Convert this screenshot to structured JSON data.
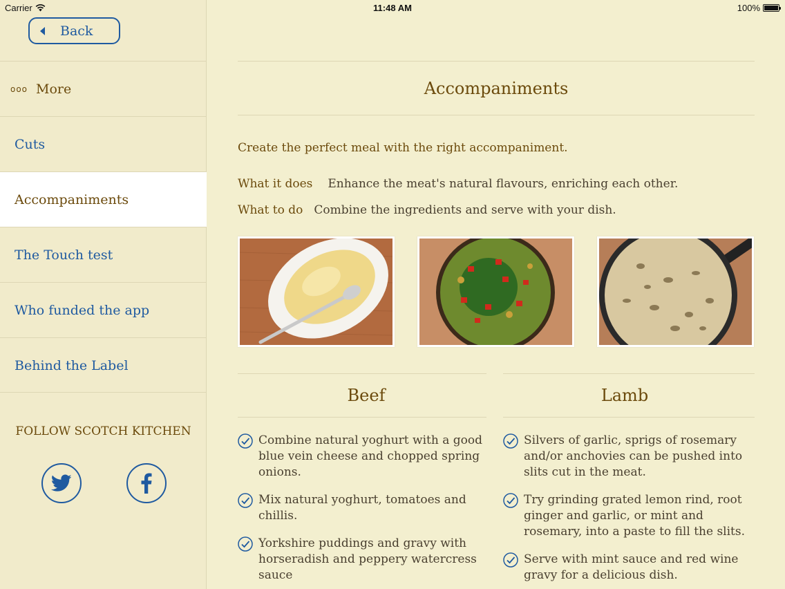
{
  "status": {
    "carrier": "Carrier",
    "time": "11:48 AM",
    "battery": "100%"
  },
  "sidebar": {
    "back_label": "Back",
    "more_label": "More",
    "more_dots": "ooo",
    "items": [
      {
        "label": "Cuts"
      },
      {
        "label": "Accompaniments"
      },
      {
        "label": "The Touch test"
      },
      {
        "label": "Who funded the app"
      },
      {
        "label": "Behind the Label"
      }
    ],
    "follow_label": "FOLLOW SCOTCH KITCHEN",
    "social": [
      "twitter-icon",
      "facebook-icon"
    ]
  },
  "main": {
    "title": "Accompaniments",
    "intro": "Create the perfect meal with the right accompaniment.",
    "what_it_does_label": "What it does",
    "what_it_does_text": "Enhance the meat's natural flavours, enriching each other.",
    "what_to_do_label": "What to do",
    "what_to_do_text": "Combine the ingredients and serve with your dish.",
    "beef": {
      "title": "Beef",
      "items": [
        [
          "Combine natural yoghurt with a good",
          "blue vein cheese and chopped spring",
          "onions."
        ],
        [
          "Mix natural yoghurt, tomatoes and",
          "chillis."
        ],
        [
          "Yorkshire puddings and gravy with",
          "horseradish and peppery watercress",
          "sauce"
        ]
      ]
    },
    "lamb": {
      "title": "Lamb",
      "items": [
        [
          "Silvers of garlic, sprigs of rosemary",
          "and/or anchovies can be pushed into",
          "slits cut in the meat."
        ],
        [
          "Try grinding grated lemon rind, root",
          "ginger and garlic, or mint and",
          "rosemary, into a paste to fill the slits."
        ],
        [
          "Serve with mint sauce and red wine",
          "gravy for a delicious dish."
        ]
      ]
    }
  },
  "colors": {
    "link": "#1f5aa0",
    "brown": "#6b4a0c",
    "background": "#f3efcf"
  }
}
